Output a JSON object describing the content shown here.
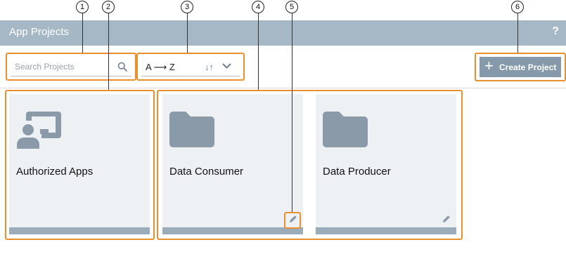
{
  "header": {
    "title": "App Projects",
    "help_label": "?"
  },
  "toolbar": {
    "search": {
      "placeholder": "Search Projects",
      "icon": "search-icon"
    },
    "sort": {
      "label": "A ⟶ Z",
      "order_icon": "↓↑"
    },
    "create_button": {
      "plus": "+",
      "label": "Create Project"
    }
  },
  "cards": [
    {
      "title": "Authorized Apps",
      "icon": "authorized-apps-icon",
      "editable": false
    },
    {
      "title": "Data Consumer",
      "icon": "folder-icon",
      "editable": true
    },
    {
      "title": "Data Producer",
      "icon": "folder-icon",
      "editable": true
    }
  ],
  "callouts": [
    "1",
    "2",
    "3",
    "4",
    "5",
    "6"
  ],
  "colors": {
    "header": "#a6b8c6",
    "button": "#8599aa",
    "card": "#eef1f4",
    "card_bar": "#9aabb9",
    "icon": "#8a9aa8",
    "annotation": "#e8902f"
  }
}
